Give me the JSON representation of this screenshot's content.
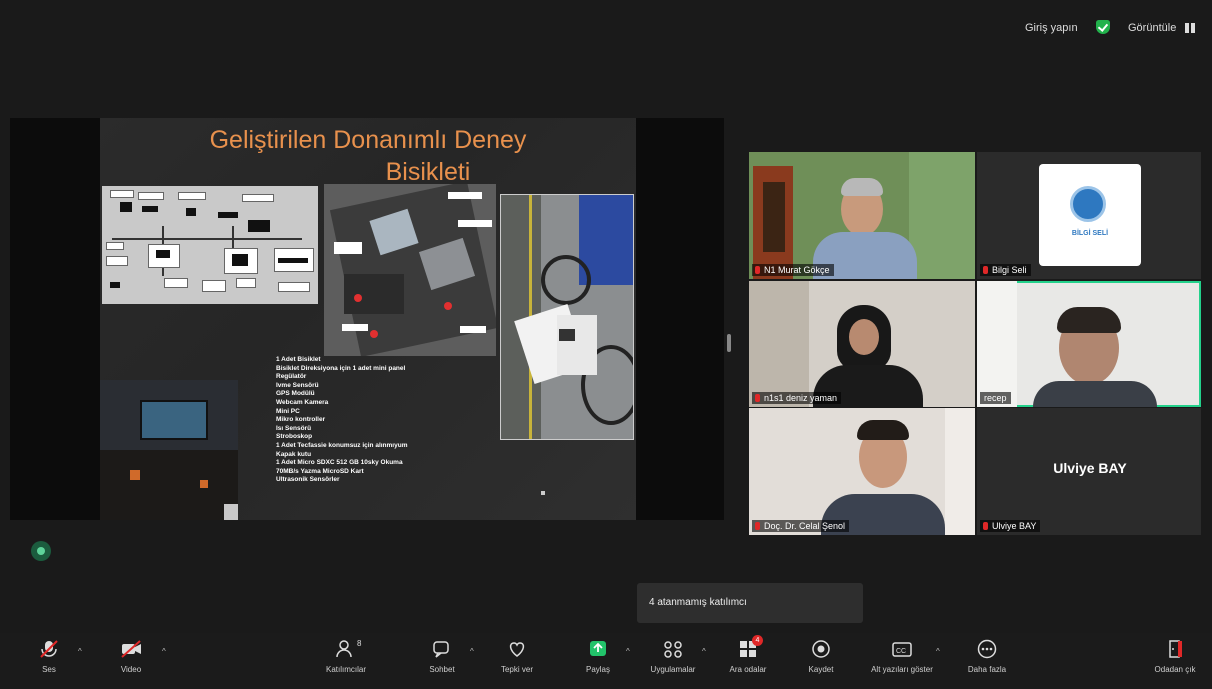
{
  "topbar": {
    "signin_label": "Giriş yapın",
    "view_label": "Görüntüle"
  },
  "slide": {
    "title_line1": "Geliştirilen Donanımlı Deney",
    "title_line2": "Bisikleti",
    "items": [
      "1 Adet Bisiklet",
      "Bisiklet Direksiyona için 1 adet mini panel",
      "Regülatör",
      "Ivme Sensörü",
      "GPS Modülü",
      "Webcam Kamera",
      "Mini PC",
      "Mikro kontroller",
      "Isı Sensörü",
      "Stroboskop",
      "1 Adet Tecfassie konumsuz için alınmıyum",
      "Kapak kutu",
      "1 Adet Micro SDXC 512 GB 10sky Okuma",
      "70MB/s Yazma MicroSD Kart",
      "Ultrasonik Sensörler"
    ]
  },
  "participants": [
    {
      "name": "N1 Murat Gökçe"
    },
    {
      "name": "Bilgi Seli",
      "logo_text": "BİLGİ SELİ"
    },
    {
      "name": "n1s1 deniz yaman"
    },
    {
      "name": "recep"
    },
    {
      "name": "Doç. Dr. Celal Şenol"
    },
    {
      "name": "Ulviye BAY",
      "display_name": "Ulviye BAY"
    }
  ],
  "notice": "4 atanmamış katılımcı",
  "toolbar": {
    "audio": "Ses",
    "video": "Video",
    "participants": "Katılımcılar",
    "participants_count": "8",
    "chat": "Sohbet",
    "react": "Tepki ver",
    "share": "Paylaş",
    "apps": "Uygulamalar",
    "rooms": "Ara odalar",
    "rooms_badge": "4",
    "record": "Kaydet",
    "captions": "Alt yazıları göster",
    "more": "Daha fazla",
    "leave": "Odadan çık"
  },
  "colors": {
    "title": "#e8914d",
    "active_speaker": "#23d18b",
    "share_green": "#22c36a",
    "muted": "#e02828"
  }
}
